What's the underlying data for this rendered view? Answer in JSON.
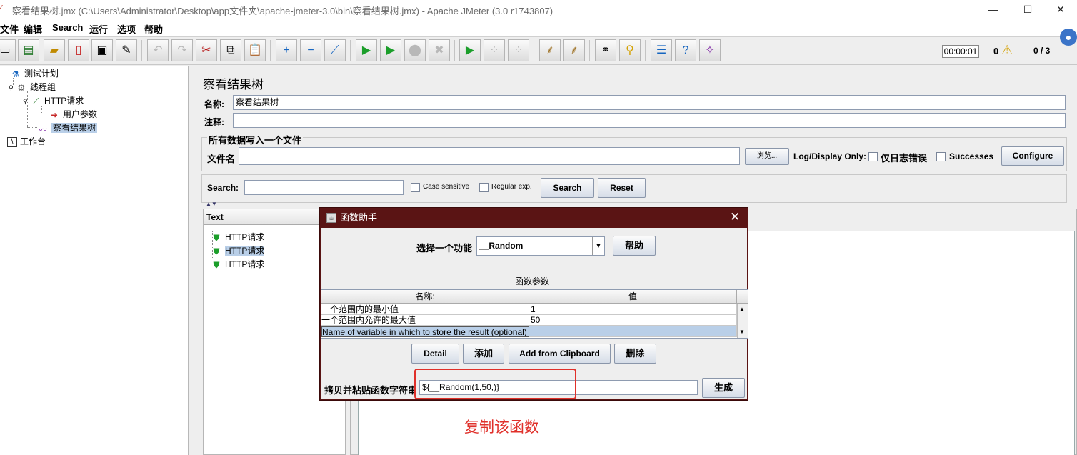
{
  "window": {
    "title": "察看结果树.jmx (C:\\Users\\Administrator\\Desktop\\app文件夹\\apache-jmeter-3.0\\bin\\察看结果树.jmx) - Apache JMeter (3.0 r1743807)",
    "minimize": "—",
    "maximize": "☐",
    "close": "✕"
  },
  "menu": [
    "文件",
    "编辑",
    "Search",
    "运行",
    "选项",
    "帮助"
  ],
  "toolbar": {
    "timer": "00:00:01",
    "error_count": "0",
    "threads": "0 / 3"
  },
  "tree": {
    "nodes": [
      {
        "label": "测试计划",
        "icon": "flask-icon"
      },
      {
        "label": "线程组",
        "icon": "gear-icon"
      },
      {
        "label": "HTTP请求",
        "icon": "pipette-icon"
      },
      {
        "label": "用户参数",
        "icon": "document-icon"
      },
      {
        "label": "察看结果树",
        "icon": "chart-icon"
      },
      {
        "label": "工作台",
        "icon": "workbench-icon"
      }
    ]
  },
  "panel": {
    "title": "察看结果树",
    "name_label": "名称:",
    "name_value": "察看结果树",
    "comment_label": "注释:",
    "comment_value": "",
    "file_group": "所有数据写入一个文件",
    "file_label": "文件名",
    "file_value": "",
    "browse": "浏览...",
    "log_display": "Log/Display Only:",
    "errors_only": "仅日志错误",
    "successes": "Successes",
    "configure": "Configure",
    "search_label": "Search:",
    "search_value": "",
    "case_sensitive": "Case sensitive",
    "regular_exp": "Regular exp.",
    "search_btn": "Search",
    "reset_btn": "Reset",
    "results_header": "Text",
    "results": [
      "HTTP请求",
      "HTTP请求",
      "HTTP请求"
    ]
  },
  "dialog": {
    "title": "函数助手",
    "choose_label": "选择一个功能",
    "function_value": "__Random",
    "help_btn": "帮助",
    "params_title": "函数参数",
    "col_name": "名称:",
    "col_value": "值",
    "rows": [
      {
        "name": "一个范围内的最小值",
        "value": "1"
      },
      {
        "name": "一个范围内允许的最大值",
        "value": "50"
      },
      {
        "name": "Name of variable in which to store the result (optional)",
        "value": ""
      }
    ],
    "detail_btn": "Detail",
    "add_btn": "添加",
    "clipboard_btn": "Add from Clipboard",
    "delete_btn": "删除",
    "copy_label": "拷贝并粘贴函数字符串",
    "function_string": "${__Random(1,50,)}",
    "generate_btn": "生成"
  },
  "annotation": {
    "text": "复制该函数",
    "color": "#e0302a"
  }
}
